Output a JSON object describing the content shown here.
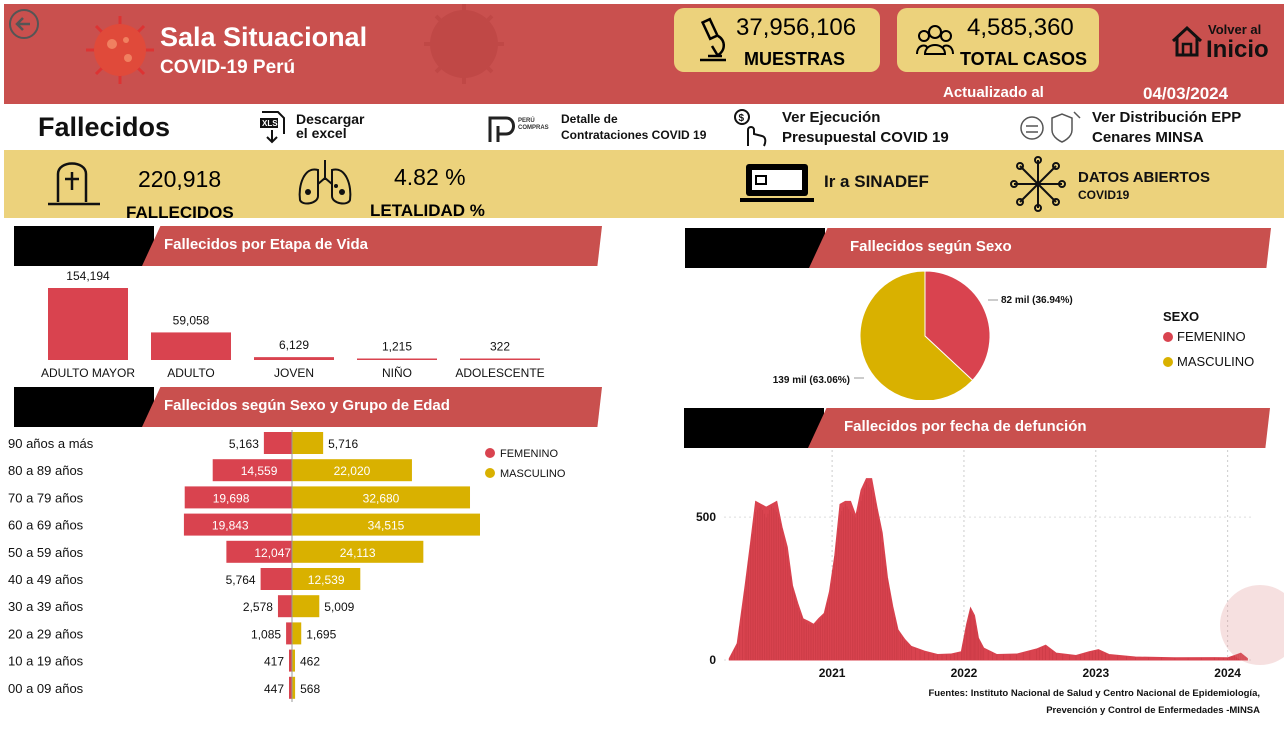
{
  "header": {
    "title": "Sala Situacional",
    "subtitle": "COVID-19 Perú",
    "muestras_value": "37,956,106",
    "muestras_label": "MUESTRAS",
    "casos_value": "4,585,360",
    "casos_label": "TOTAL CASOS",
    "volver_line1": "Volver al",
    "volver_line2": "Inicio",
    "updated_label": "Actualizado al",
    "updated_date": "04/03/2024"
  },
  "links": {
    "page_title": "Fallecidos",
    "excel_line1": "Descargar",
    "excel_line2": "el excel",
    "peru_compras_logo": "PERÚ COMPRAS",
    "contrat_line1": "Detalle  de",
    "contrat_line2": "Contrataciones COVID 19",
    "ejec_line1": "Ver Ejecución",
    "ejec_line2": "Presupuestal COVID 19",
    "epp_line1": "Ver Distribución EPP",
    "epp_line2": "Cenares MINSA"
  },
  "kpis": {
    "fallecidos_value": "220,918",
    "fallecidos_label": "FALLECIDOS",
    "letalidad_value": "4.82 %",
    "letalidad_label": "LETALIDAD %",
    "sinadef_label": "Ir a SINADEF",
    "datos_line1": "DATOS ABIERTOS",
    "datos_line2": "COVID19"
  },
  "colors": {
    "red": "#d9434f",
    "yellow": "#d9b100",
    "header": "#c9504e",
    "kpi_bg": "#ecd27c"
  },
  "icons": [
    "back-arrow-icon",
    "virus-icon",
    "microscope-icon",
    "people-icon",
    "home-icon",
    "excel-download-icon",
    "peru-compras-icon",
    "budget-hand-icon",
    "epp-icon",
    "tombstone-icon",
    "lungs-icon",
    "computer-icon",
    "network-icon"
  ],
  "charts": {
    "etapa_title": "Fallecidos por Etapa de Vida",
    "sexo_title": "Fallecidos según Sexo",
    "grupo_title": "Fallecidos según Sexo y Grupo de Edad",
    "fecha_title": "Fallecidos por fecha de defunción",
    "sexo_legend_title": "SEXO",
    "source_line1": "Fuentes: Instituto Nacional de Salud y Centro Nacional de Epidemiología,",
    "source_line2": "Prevención y Control de Enfermedades -MINSA"
  },
  "chart_data": [
    {
      "type": "bar",
      "title": "Fallecidos por Etapa de Vida",
      "categories": [
        "ADULTO MAYOR",
        "ADULTO",
        "JOVEN",
        "NIÑO",
        "ADOLESCENTE"
      ],
      "values": [
        154194,
        59058,
        6129,
        1215,
        322
      ],
      "labels": [
        "154,194",
        "59,058",
        "6,129",
        "1,215",
        "322"
      ]
    },
    {
      "type": "pie",
      "title": "Fallecidos según Sexo",
      "categories": [
        "FEMENINO",
        "MASCULINO"
      ],
      "values": [
        36.94,
        63.06
      ],
      "labels": [
        "82 mil (36.94%)",
        "139 mil (63.06%)"
      ],
      "legend": "right"
    },
    {
      "type": "bar",
      "title": "Fallecidos según Sexo y Grupo de Edad",
      "categories": [
        "90 años a más",
        "80 a 89 años",
        "70 a 79 años",
        "60 a 69 años",
        "50 a 59 años",
        "40 a 49 años",
        "30 a 39 años",
        "20 a 29 años",
        "10 a 19 años",
        "00 a 09 años"
      ],
      "series": [
        {
          "name": "FEMENINO",
          "values": [
            5163,
            14559,
            19698,
            19843,
            12047,
            5764,
            2578,
            1085,
            417,
            447
          ],
          "labels": [
            "5,163",
            "14,559",
            "19,698",
            "19,843",
            "12,047",
            "5,764",
            "2,578",
            "1,085",
            "417",
            "447"
          ]
        },
        {
          "name": "MASCULINO",
          "values": [
            5716,
            22020,
            32680,
            34515,
            24113,
            12539,
            5009,
            1695,
            462,
            568
          ],
          "labels": [
            "5,716",
            "22,020",
            "32,680",
            "34,515",
            "24,113",
            "12,539",
            "5,009",
            "1,695",
            "462",
            "568"
          ]
        }
      ],
      "legend": "top-right"
    },
    {
      "type": "bar",
      "title": "Fallecidos por fecha de defunción",
      "x_ticks": [
        "2021",
        "2022",
        "2023",
        "2024"
      ],
      "y_ticks": [
        "0",
        "500"
      ],
      "ylim": [
        0,
        700
      ],
      "series_profile": [
        [
          2020.22,
          5
        ],
        [
          2020.28,
          60
        ],
        [
          2020.34,
          250
        ],
        [
          2020.38,
          420
        ],
        [
          2020.42,
          540
        ],
        [
          2020.46,
          560
        ],
        [
          2020.5,
          520
        ],
        [
          2020.54,
          560
        ],
        [
          2020.58,
          540
        ],
        [
          2020.62,
          480
        ],
        [
          2020.66,
          380
        ],
        [
          2020.7,
          270
        ],
        [
          2020.74,
          190
        ],
        [
          2020.78,
          150
        ],
        [
          2020.82,
          130
        ],
        [
          2020.86,
          130
        ],
        [
          2020.9,
          140
        ],
        [
          2020.94,
          170
        ],
        [
          2020.98,
          230
        ],
        [
          2021.02,
          380
        ],
        [
          2021.06,
          530
        ],
        [
          2021.1,
          570
        ],
        [
          2021.14,
          540
        ],
        [
          2021.18,
          520
        ],
        [
          2021.22,
          580
        ],
        [
          2021.26,
          650
        ],
        [
          2021.3,
          620
        ],
        [
          2021.34,
          550
        ],
        [
          2021.38,
          430
        ],
        [
          2021.42,
          300
        ],
        [
          2021.46,
          180
        ],
        [
          2021.5,
          110
        ],
        [
          2021.55,
          70
        ],
        [
          2021.6,
          50
        ],
        [
          2021.7,
          30
        ],
        [
          2021.8,
          20
        ],
        [
          2021.9,
          20
        ],
        [
          2021.98,
          30
        ],
        [
          2022.02,
          120
        ],
        [
          2022.05,
          190
        ],
        [
          2022.08,
          150
        ],
        [
          2022.11,
          80
        ],
        [
          2022.15,
          40
        ],
        [
          2022.25,
          20
        ],
        [
          2022.4,
          20
        ],
        [
          2022.55,
          40
        ],
        [
          2022.62,
          50
        ],
        [
          2022.7,
          25
        ],
        [
          2022.85,
          15
        ],
        [
          2022.95,
          30
        ],
        [
          2023.02,
          35
        ],
        [
          2023.1,
          20
        ],
        [
          2023.3,
          10
        ],
        [
          2023.6,
          8
        ],
        [
          2023.9,
          8
        ],
        [
          2024.0,
          8
        ],
        [
          2024.05,
          15
        ],
        [
          2024.1,
          25
        ],
        [
          2024.15,
          5
        ]
      ]
    }
  ]
}
